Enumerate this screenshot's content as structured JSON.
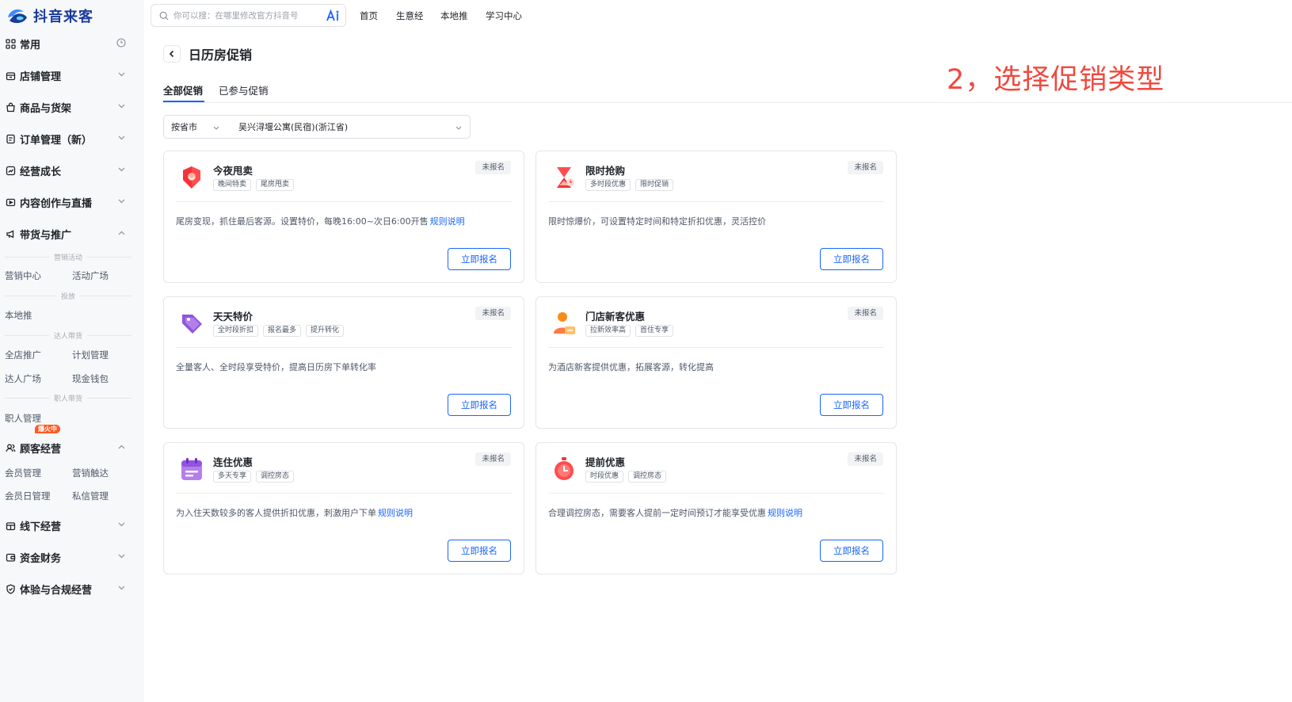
{
  "brand": {
    "name": "抖音来客"
  },
  "search": {
    "placeholder": "你可以搜：在哪里修改官方抖音号"
  },
  "topnav": [
    "首页",
    "生意经",
    "本地推",
    "学习中心"
  ],
  "sidebar": {
    "groups": [
      {
        "label": "常用",
        "icon": "grid-icon"
      },
      {
        "label": "店铺管理",
        "icon": "store-icon"
      },
      {
        "label": "商品与货架",
        "icon": "bag-icon"
      },
      {
        "label": "订单管理（新）",
        "icon": "order-icon"
      },
      {
        "label": "经营成长",
        "icon": "growth-icon"
      },
      {
        "label": "内容创作与直播",
        "icon": "live-icon"
      },
      {
        "label": "带货与推广",
        "icon": "megaphone-icon"
      },
      {
        "label": "顾客经营",
        "icon": "users-icon"
      },
      {
        "label": "线下经营",
        "icon": "offline-store-icon"
      },
      {
        "label": "资金财务",
        "icon": "wallet-icon"
      },
      {
        "label": "体验与合规经营",
        "icon": "shield-icon"
      }
    ],
    "promo_sections": {
      "marketing": "营销活动",
      "ads": "投放",
      "kol": "达人带货",
      "staff": "职人带货"
    },
    "promo_items": {
      "marketing_center": "营销中心",
      "activity_square": "活动广场",
      "local_push": "本地推",
      "store_promo": "全店推广",
      "plan_manage": "计划管理",
      "kol_square": "达人广场",
      "cash_wallet": "现金钱包",
      "staff_manage": "职人管理"
    },
    "hot_badge": "爆火中",
    "customer_items": {
      "member_manage": "会员管理",
      "marketing_reach": "营销触达",
      "member_day": "会员日管理",
      "dm_manage": "私信管理"
    }
  },
  "page": {
    "title": "日历房促销",
    "tabs": [
      {
        "label": "全部促销",
        "active": true
      },
      {
        "label": "已参与促销",
        "active": false
      }
    ],
    "filter": {
      "scope": "按省市",
      "hotel": "吴兴浔堰公寓(民宿)(浙江省)"
    }
  },
  "cards": [
    {
      "title": "今夜甩卖",
      "icon": "flame-tag-icon",
      "tags": [
        "晚间特卖",
        "尾房甩卖"
      ],
      "status": "未报名",
      "desc": "尾房变现，抓住最后客源。设置特价，每晚16:00~次日6:00开售",
      "link": "规则说明",
      "button": "立即报名"
    },
    {
      "title": "限时抢购",
      "icon": "hourglass-icon",
      "tags": [
        "多时段优惠",
        "限时促销"
      ],
      "status": "未报名",
      "desc": "限时惊爆价，可设置特定时间和特定折扣优惠，灵活控价",
      "link": "",
      "button": "立即报名"
    },
    {
      "title": "天天特价",
      "icon": "price-tag-icon",
      "tags": [
        "全时段折扣",
        "报名最多",
        "提升转化"
      ],
      "status": "未报名",
      "desc": "全量客人、全时段享受特价，提高日历房下单转化率",
      "link": "",
      "button": "立即报名"
    },
    {
      "title": "门店新客优惠",
      "icon": "new-customer-icon",
      "tags": [
        "拉新效率高",
        "首住专享"
      ],
      "status": "未报名",
      "desc": "为酒店新客提供优惠，拓展客源，转化提高",
      "link": "",
      "button": "立即报名"
    },
    {
      "title": "连住优惠",
      "icon": "calendar-icon",
      "tags": [
        "多天专享",
        "调控房态"
      ],
      "status": "未报名",
      "desc": "为入住天数较多的客人提供折扣优惠，刺激用户下单",
      "link": "规则说明",
      "button": "立即报名"
    },
    {
      "title": "提前优惠",
      "icon": "stopwatch-icon",
      "tags": [
        "时段优惠",
        "调控房态"
      ],
      "status": "未报名",
      "desc": "合理调控房态，需要客人提前一定时间预订才能享受优惠",
      "link": "规则说明",
      "button": "立即报名"
    }
  ],
  "annotation": "2，选择促销类型",
  "colors": {
    "primary": "#1966ff",
    "annotation": "#f0493e",
    "sidebar_bg": "#f7f8fa",
    "hot_badge": "#ff5a26"
  }
}
